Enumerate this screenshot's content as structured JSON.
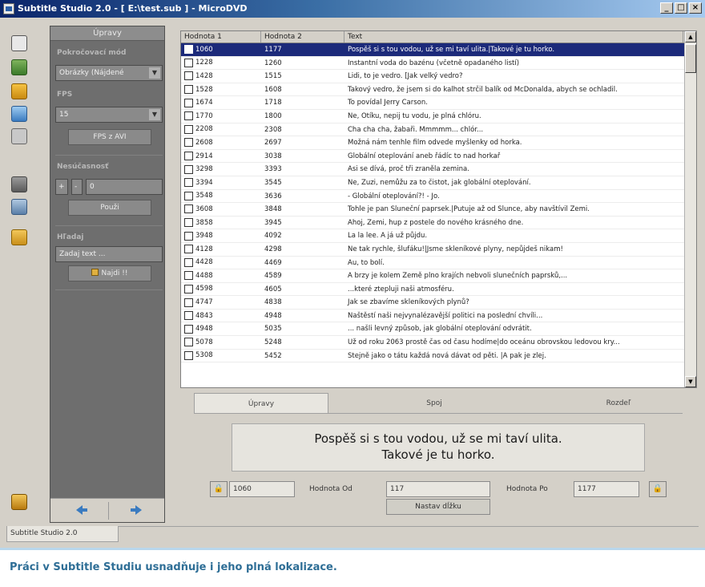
{
  "window": {
    "title": "Subtitle Studio 2.0 - [ E:\\test.sub ] - MicroDVD",
    "buttons": [
      "_",
      "□",
      "×"
    ]
  },
  "toolbar_icons": [
    "document-icon",
    "open-file-icon",
    "save-icon",
    "image-icon",
    "settings-icon",
    "cut-icon",
    "export-icon",
    "folder-icon",
    "exit-icon"
  ],
  "panel": {
    "header": "Úpravy",
    "mode_label": "Pokročovací mód",
    "mode_value": "Obrázky (Nájdené",
    "fps_label": "FPS",
    "fps_value": "15",
    "fps_avi_button": "FPS z AVI",
    "sync_label": "Nesúčasnosť",
    "sync_sign_plus": "+",
    "sync_sign_minus": "-",
    "sync_value": "0",
    "sync_button": "Použi",
    "search_label": "Hľadaj",
    "search_placeholder": "Zadaj text ...",
    "search_button": "Najdi !!"
  },
  "table": {
    "columns": [
      "Hodnota 1",
      "Hodnota 2",
      "Text"
    ],
    "rows": [
      {
        "v1": "1060",
        "v2": "1177",
        "text": "Pospěš si s tou vodou, už se mi taví ulita.|Takové je tu horko.",
        "selected": true
      },
      {
        "v1": "1228",
        "v2": "1260",
        "text": "Instantní voda do bazénu (včetně opadaného listí)"
      },
      {
        "v1": "1428",
        "v2": "1515",
        "text": "Lidi, to je vedro. [Jak velký vedro?"
      },
      {
        "v1": "1528",
        "v2": "1608",
        "text": "Takový vedro, že jsem si do kalhot strčil balík od McDonalda, abych se ochladil."
      },
      {
        "v1": "1674",
        "v2": "1718",
        "text": "To povídal Jerry Carson."
      },
      {
        "v1": "1770",
        "v2": "1800",
        "text": "Ne, Otíku, nepij tu vodu, je plná chlóru."
      },
      {
        "v1": "2208",
        "v2": "2308",
        "text": "Cha cha cha, žabaři. Mmmmm... chlór..."
      },
      {
        "v1": "2608",
        "v2": "2697",
        "text": "Možná nám tenhle film odvede myšlenky od horka."
      },
      {
        "v1": "2914",
        "v2": "3038",
        "text": "Globální oteplování aneb řádíc to nad horkař"
      },
      {
        "v1": "3298",
        "v2": "3393",
        "text": "Asi se dívá, proč tři zraněla zemina."
      },
      {
        "v1": "3394",
        "v2": "3545",
        "text": "Ne, Zuzi, nemůžu za to čistot, jak globální oteplování."
      },
      {
        "v1": "3548",
        "v2": "3636",
        "text": "- Globální oteplování?! - Jo."
      },
      {
        "v1": "3608",
        "v2": "3848",
        "text": "Tohle je pan Sluneční paprsek.|Putuje až od Slunce, aby navštívil Zemi."
      },
      {
        "v1": "3858",
        "v2": "3945",
        "text": "Ahoj, Zemi, hup z postele do nového krásného dne."
      },
      {
        "v1": "3948",
        "v2": "4092",
        "text": "La la lee. A já už půjdu."
      },
      {
        "v1": "4128",
        "v2": "4298",
        "text": "Ne tak rychle, šlufáku!|Jsme skleníkové plyny, nepůjdeš nikam!"
      },
      {
        "v1": "4428",
        "v2": "4469",
        "text": "Au, to bolí."
      },
      {
        "v1": "4488",
        "v2": "4589",
        "text": "A brzy je kolem Země plno krajích nebvoli slunečních paprsků,..."
      },
      {
        "v1": "4598",
        "v2": "4605",
        "text": "...které ztepluji naši atmosféru."
      },
      {
        "v1": "4747",
        "v2": "4838",
        "text": "Jak se zbavíme skleníkových plynů?"
      },
      {
        "v1": "4843",
        "v2": "4948",
        "text": "Naštěstí naši nejvynalézavější politici na poslední chvíli..."
      },
      {
        "v1": "4948",
        "v2": "5035",
        "text": "... našli levný způsob, jak globální oteplování odvrátit."
      },
      {
        "v1": "5078",
        "v2": "5248",
        "text": "Už od roku 2063 prostě čas od času hodíme|do oceánu obrovskou ledovou kry..."
      },
      {
        "v1": "5308",
        "v2": "5452",
        "text": "Stejně jako o tátu každá nová dávat od pěti. |A pak je zlej."
      }
    ]
  },
  "tabs": [
    "Úpravy",
    "Spoj",
    "Rozdeľ"
  ],
  "preview": {
    "line1": "Pospěš si s tou vodou, už se mi taví ulita.",
    "line2": "Takové je tu horko."
  },
  "bottom": {
    "lock_left": "🔒",
    "from_frame": "1060",
    "label_from": "Hodnota Od",
    "from_value": "117",
    "label_to": "Hodnota Po",
    "to_value": "1177",
    "lock_right": "🔒",
    "length_button": "Nastav dĺžku"
  },
  "status_tab": "Subtitle Studio 2.0",
  "caption": "Práci v Subtitle Studiu usnadňuje i jeho plná lokalizace.",
  "colors": {
    "selection": "#1c2a7a",
    "panel": "#6e6e6e",
    "caption_text": "#2e6e96"
  }
}
